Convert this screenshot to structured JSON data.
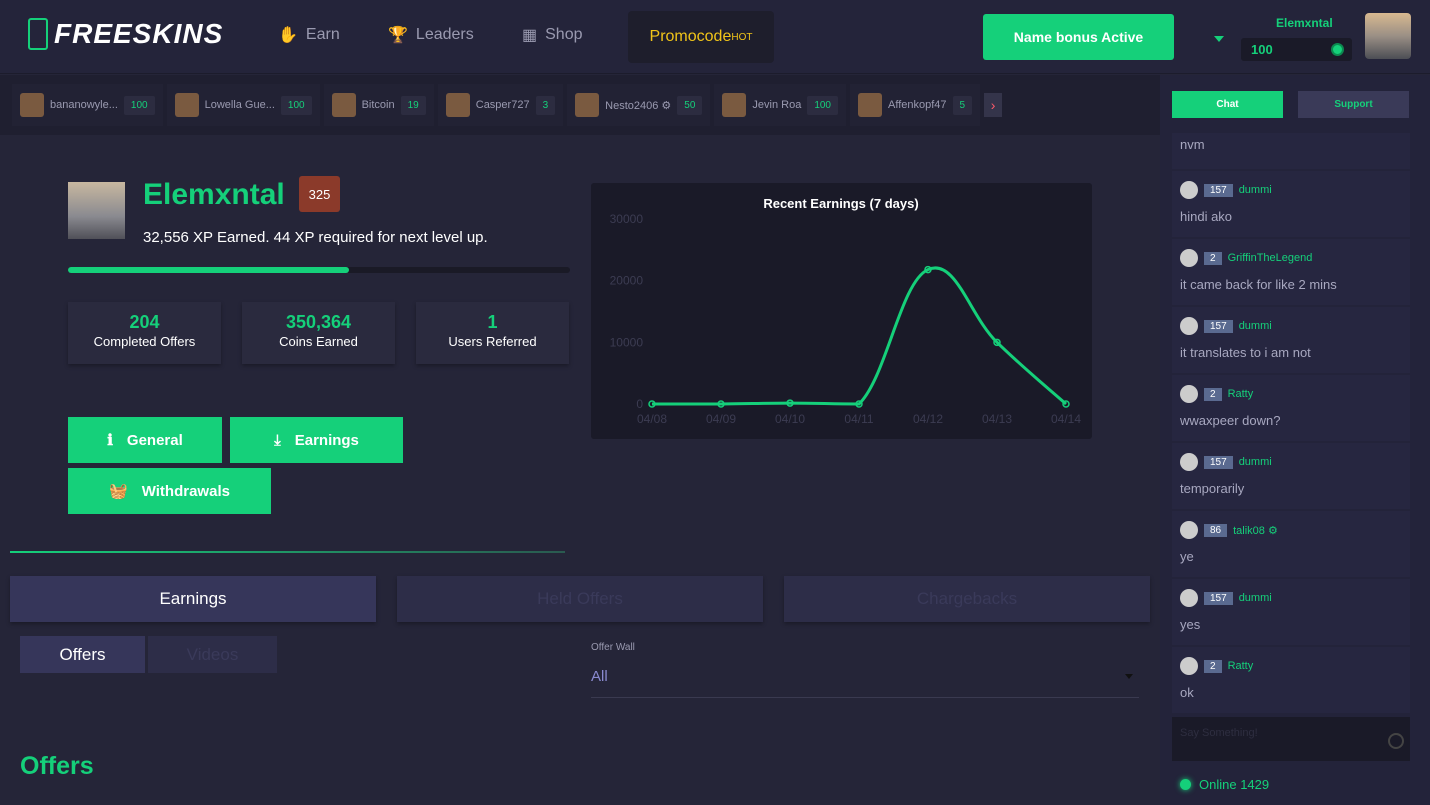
{
  "header": {
    "logo": "FREESKINS",
    "nav": [
      {
        "label": "Earn",
        "icon": "hand-coin-icon"
      },
      {
        "label": "Leaders",
        "icon": "trophy-icon"
      },
      {
        "label": "Shop",
        "icon": "store-icon"
      }
    ],
    "promocode": "Promocode",
    "promo_badge": "HOT",
    "bonus": "Name bonus Active",
    "username": "Elemxntal",
    "balance": "100"
  },
  "ticker": [
    {
      "name": "bananowyle...",
      "value": "100"
    },
    {
      "name": "Lowella Gue...",
      "value": "100"
    },
    {
      "name": "Bitcoin",
      "value": "19"
    },
    {
      "name": "Casper727",
      "value": "3"
    },
    {
      "name": "Nesto2406 ⚙",
      "value": "50"
    },
    {
      "name": "Jevin Roa",
      "value": "100"
    },
    {
      "name": "Affenkopf47",
      "value": "5"
    }
  ],
  "profile": {
    "name": "Elemxntal",
    "level": "325",
    "xp_text": "32,556 XP Earned. 44 XP required for next level up.",
    "progress_percent": 56,
    "stats": [
      {
        "value": "204",
        "label": "Completed Offers"
      },
      {
        "value": "350,364",
        "label": "Coins Earned"
      },
      {
        "value": "1",
        "label": "Users Referred"
      }
    ],
    "buttons": [
      "General",
      "Earnings",
      "Withdrawals"
    ]
  },
  "chart_data": {
    "type": "line",
    "title": "Recent Earnings (7 days)",
    "categories": [
      "04/08",
      "04/09",
      "04/10",
      "04/11",
      "04/12",
      "04/13",
      "04/14"
    ],
    "values": [
      0,
      0,
      150,
      0,
      21800,
      10000,
      0
    ],
    "yticks": [
      "0",
      "10000",
      "20000",
      "30000"
    ],
    "ylim": [
      0,
      30000
    ],
    "color": "#15d07a",
    "grid": false
  },
  "tabs": [
    "Earnings",
    "Held Offers",
    "Chargebacks"
  ],
  "subtabs": [
    "Offers",
    "Videos"
  ],
  "offerwall": {
    "label": "Offer Wall",
    "value": "All"
  },
  "section_title": "Offers",
  "chat": {
    "tabs": [
      "Chat",
      "Support"
    ],
    "first": "nvm",
    "messages": [
      {
        "user": "dummi",
        "level": "157",
        "text": "hindi ako"
      },
      {
        "user": "GriffinTheLegend",
        "level": "2",
        "text": "it came back for like 2 mins"
      },
      {
        "user": "dummi",
        "level": "157",
        "text": "it translates to i am not"
      },
      {
        "user": "Ratty",
        "level": "2",
        "text": "wwaxpeer down?"
      },
      {
        "user": "dummi",
        "level": "157",
        "text": "temporarily"
      },
      {
        "user": "talik08 ⚙",
        "level": "86",
        "text": "ye"
      },
      {
        "user": "dummi",
        "level": "157",
        "text": "yes"
      },
      {
        "user": "Ratty",
        "level": "2",
        "text": "ok"
      }
    ],
    "placeholder": "Say Something!",
    "online": "Online 1429"
  },
  "colors": {
    "accent": "#15d07a",
    "bg": "#252538"
  }
}
